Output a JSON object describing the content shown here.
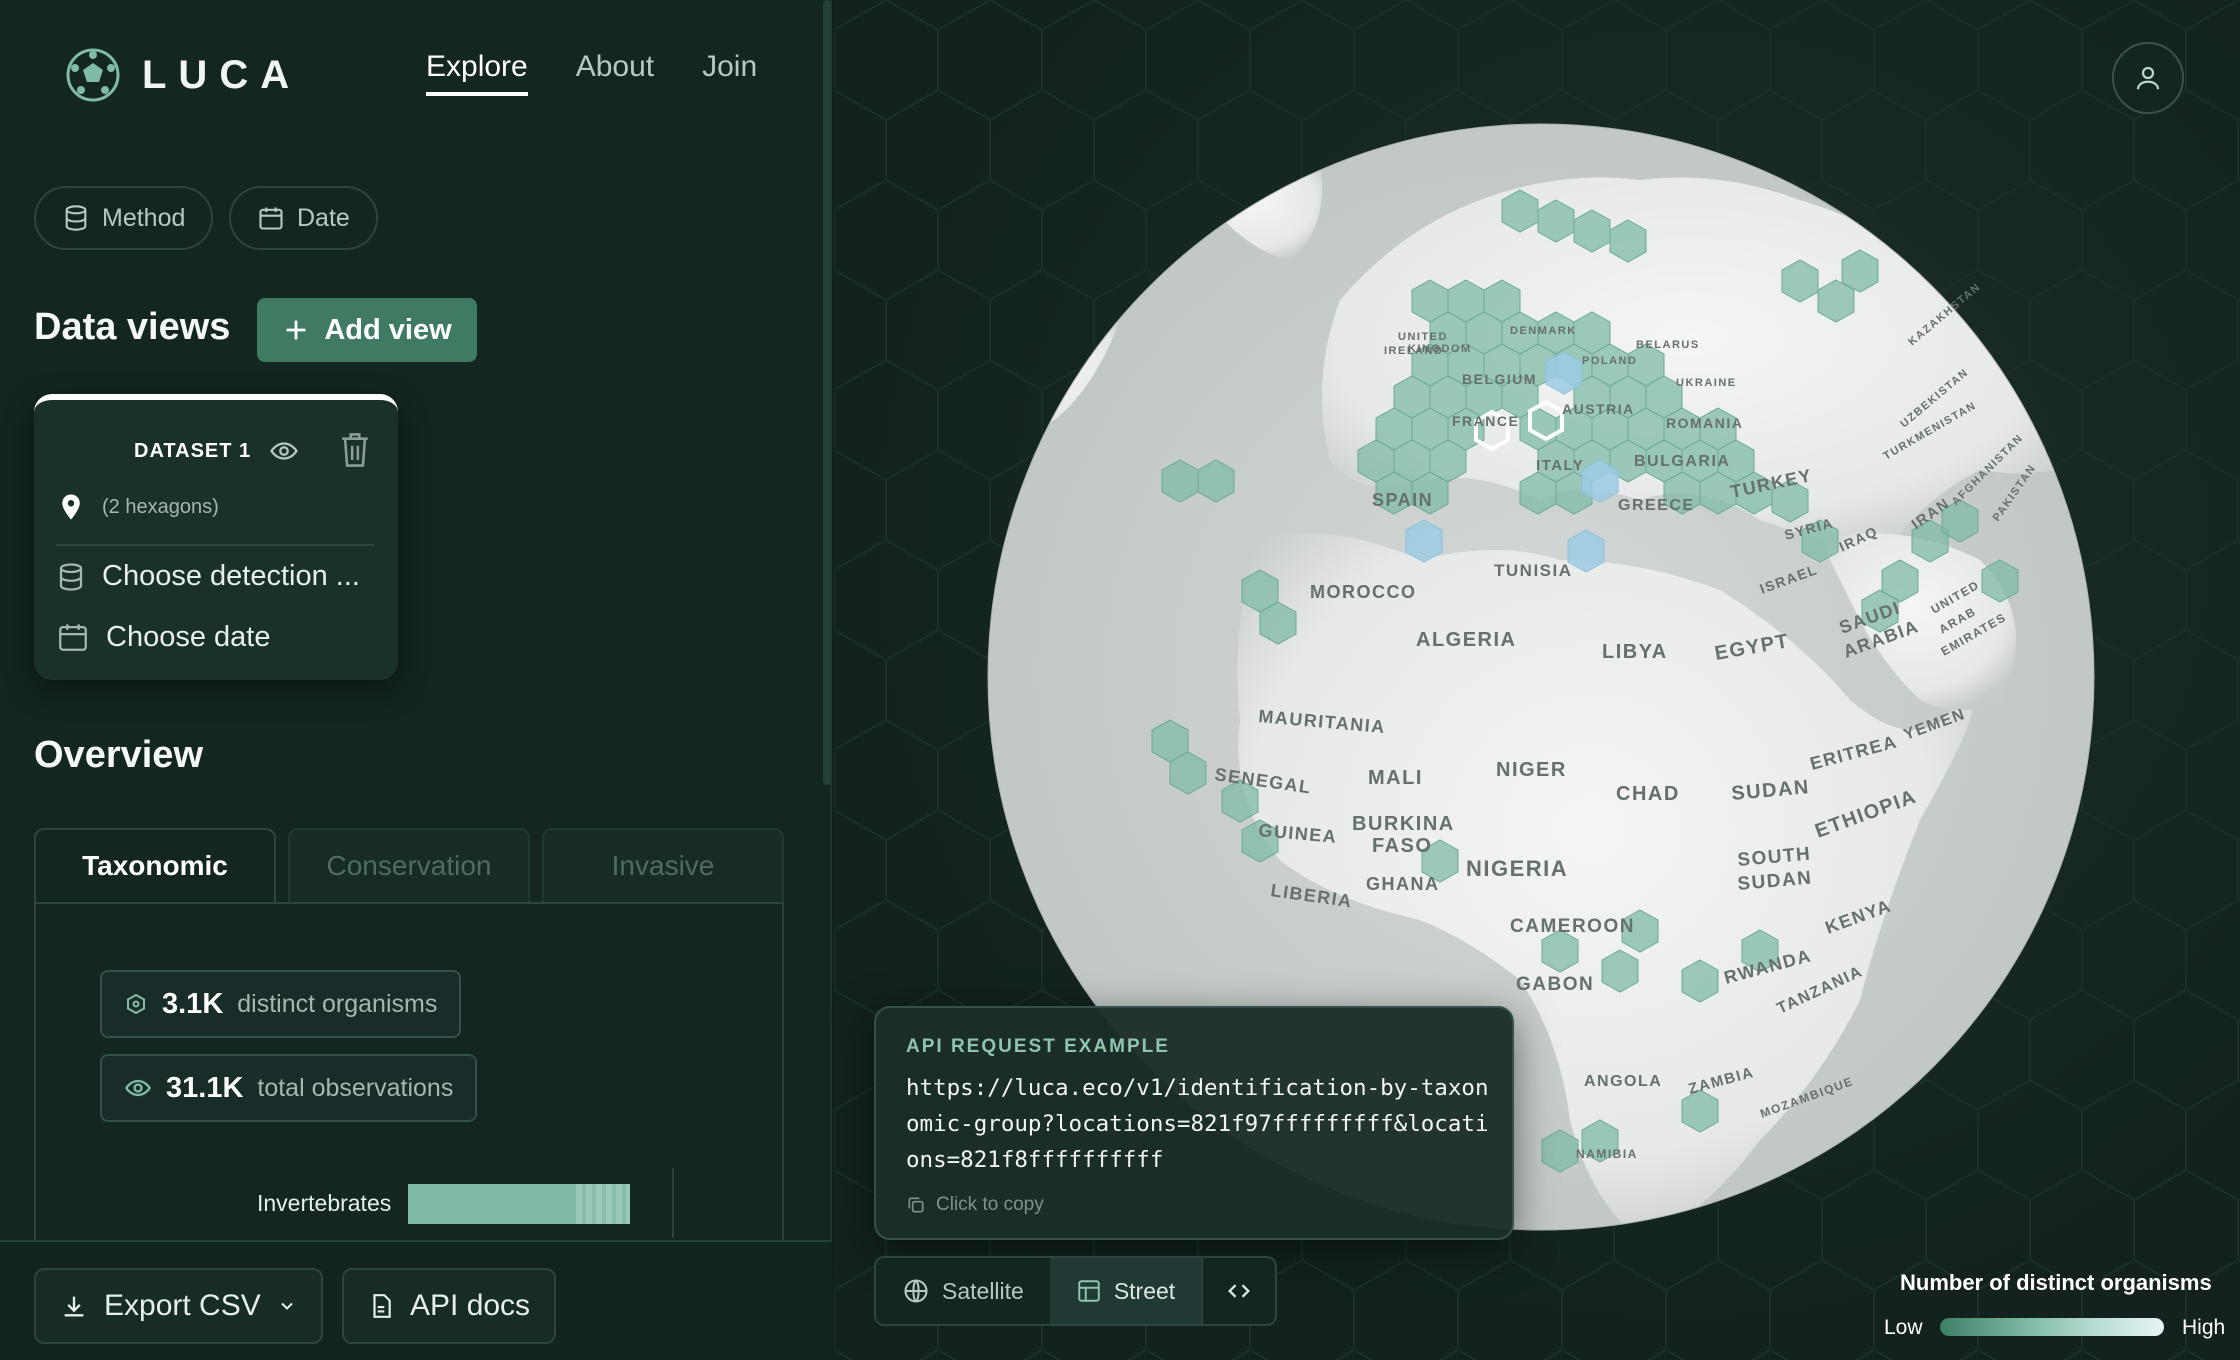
{
  "app": {
    "name": "LUCA"
  },
  "nav": {
    "items": [
      {
        "label": "Explore",
        "active": true
      },
      {
        "label": "About"
      },
      {
        "label": "Join"
      }
    ]
  },
  "filters": {
    "method_label": "Method",
    "date_label": "Date"
  },
  "data_views": {
    "title": "Data views",
    "add_label": "Add view",
    "dataset": {
      "title": "DATASET 1",
      "location_text": "(2 hexagons)",
      "detection_label": "Choose detection ...",
      "date_label": "Choose date"
    }
  },
  "overview": {
    "title": "Overview",
    "tabs": [
      {
        "label": "Taxonomic",
        "active": true
      },
      {
        "label": "Conservation"
      },
      {
        "label": "Invasive"
      }
    ],
    "stats": [
      {
        "value": "3.1K",
        "label": "distinct organisms"
      },
      {
        "value": "31.1K",
        "label": "total observations"
      }
    ],
    "bars": [
      {
        "label": "Invertebrates"
      }
    ]
  },
  "footer": {
    "export_label": "Export CSV",
    "api_docs_label": "API docs"
  },
  "api_example": {
    "title": "API REQUEST EXAMPLE",
    "url": "https://luca.eco/v1/identification-by-taxonomic-group?locations=821f97fffffffff&locations=821f8ffffffffff",
    "copy_label": "Click to copy"
  },
  "map_controls": {
    "satellite_label": "Satellite",
    "street_label": "Street",
    "active": "Street"
  },
  "legend": {
    "title": "Number of distinct organisms",
    "low_label": "Low",
    "high_label": "High"
  },
  "map_labels": [
    "UNITED KINGDOM",
    "IRELAND",
    "DENMARK",
    "POLAND",
    "BELARUS",
    "UKRAINE",
    "BELGIUM",
    "FRANCE",
    "AUSTRIA",
    "ROMANIA",
    "KAZAKHSTAN",
    "UZBEKISTAN",
    "TURKMENISTAN",
    "AFGHANISTAN",
    "PAKISTAN",
    "SPAIN",
    "ITALY",
    "BULGARIA",
    "GREECE",
    "TURKEY",
    "SYRIA",
    "IRAQ",
    "IRAN",
    "ISRAEL",
    "TUNISIA",
    "MOROCCO",
    "ALGERIA",
    "LIBYA",
    "EGYPT",
    "SAUDI ARABIA",
    "UNITED ARAB EMIRATES",
    "MAURITANIA",
    "MALI",
    "NIGER",
    "CHAD",
    "SUDAN",
    "ERITREA",
    "YEMEN",
    "SENEGAL",
    "GUINEA",
    "BURKINA FASO",
    "GHANA",
    "NIGERIA",
    "LIBERIA",
    "ETHIOPIA",
    "SOUTH SUDAN",
    "CAMEROON",
    "GABON",
    "KENYA",
    "RWANDA",
    "TANZANIA",
    "ANGOLA",
    "ZAMBIA",
    "MOZAMBIQUE",
    "NAMIBIA"
  ],
  "colors": {
    "accent": "#3f7a63",
    "hex_low": "#7fbba5",
    "hex_high": "#e8f3f7",
    "panel_bg": "#142622",
    "map_bg": "#13221f"
  }
}
